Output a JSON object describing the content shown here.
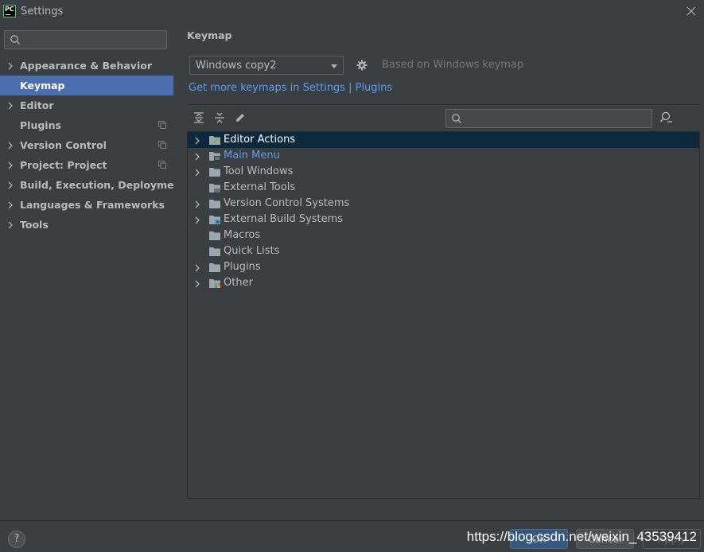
{
  "window": {
    "title": "Settings",
    "logo_text": "PC"
  },
  "sidebar": {
    "search": {
      "value": "",
      "placeholder": ""
    },
    "items": [
      {
        "label": "Appearance & Behavior"
      },
      {
        "label": "Keymap"
      },
      {
        "label": "Editor"
      },
      {
        "label": "Plugins"
      },
      {
        "label": "Version Control"
      },
      {
        "label": "Project: Project"
      },
      {
        "label": "Build, Execution, Deployment"
      },
      {
        "label": "Languages & Frameworks"
      },
      {
        "label": "Tools"
      }
    ]
  },
  "main": {
    "title": "Keymap",
    "scheme": {
      "selected": "Windows copy2"
    },
    "based_on": "Based on Windows keymap",
    "more_link": "Get more keymaps in Settings | Plugins",
    "tree_search": {
      "value": "",
      "placeholder": ""
    },
    "tree": [
      {
        "label": "Editor Actions"
      },
      {
        "label": "Main Menu"
      },
      {
        "label": "Tool Windows"
      },
      {
        "label": "External Tools"
      },
      {
        "label": "Version Control Systems"
      },
      {
        "label": "External Build Systems"
      },
      {
        "label": "Macros"
      },
      {
        "label": "Quick Lists"
      },
      {
        "label": "Plugins"
      },
      {
        "label": "Other"
      }
    ]
  },
  "footer": {
    "help": "?",
    "ok": "OK",
    "cancel": "Cancel",
    "apply": "Apply",
    "watermark": "https://blog.csdn.net/weixin_43539412"
  },
  "colors": {
    "background": "#3c3f41",
    "selection": "#4b6eaf",
    "tree_selection": "#0d293e",
    "link": "#589df6",
    "text": "#bbbbbb"
  }
}
